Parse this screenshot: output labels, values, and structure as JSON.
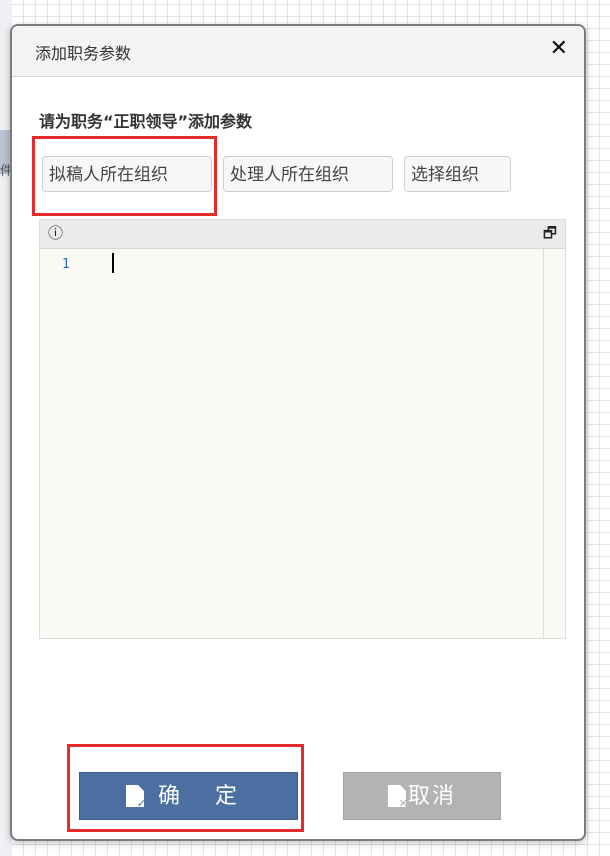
{
  "background": {
    "edge_char": "件"
  },
  "dialog": {
    "title": "添加职务参数",
    "close_symbol": "✕",
    "prompt": "请为职务“正职领导”添加参数",
    "param_buttons": [
      {
        "label": "拟稿人所在组织"
      },
      {
        "label": "处理人所在组织"
      },
      {
        "label": "选择组织"
      }
    ],
    "editor": {
      "info_icon": "ⓘ",
      "window_icon": "🗗",
      "line_number": "1"
    },
    "actions": {
      "ok_label": "确 定",
      "cancel_label": "取消",
      "ok_icon_badge": "✓",
      "cancel_icon_badge": "✕"
    }
  },
  "colors": {
    "highlight": "#e52b2b",
    "ok_button": "#4a6fa0",
    "cancel_button": "#b3b3b3",
    "line_number": "#2a6cb8"
  }
}
